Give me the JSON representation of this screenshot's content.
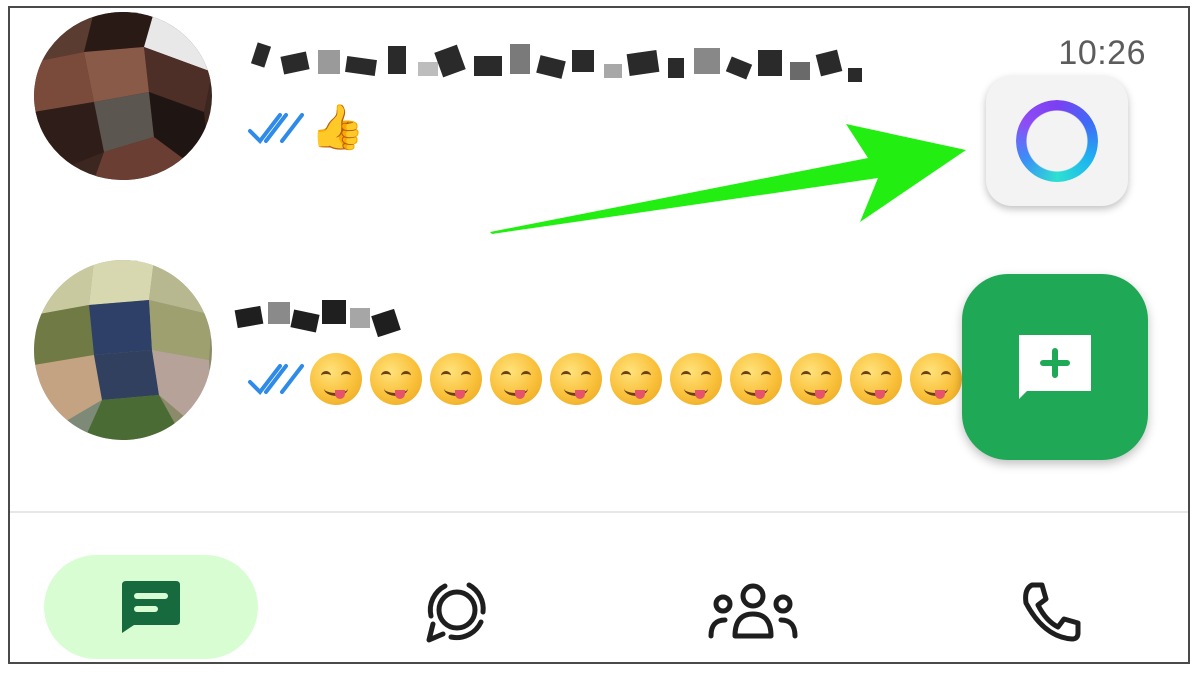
{
  "chats": [
    {
      "name": "",
      "time": "10:26",
      "preview": "👍",
      "read_receipt": "double-check-blue"
    },
    {
      "name": "",
      "time": "",
      "preview_repeat_count": 11,
      "preview_emoji": "face-savoring-food",
      "read_receipt": "double-check-blue"
    }
  ],
  "fabs": {
    "meta_ai_icon": "meta-ai-ring-icon",
    "new_chat_icon": "new-chat-plus-icon"
  },
  "bottom_nav": [
    {
      "id": "chats",
      "icon": "chats-icon",
      "active": true
    },
    {
      "id": "updates",
      "icon": "updates-status-icon",
      "active": false
    },
    {
      "id": "communities",
      "icon": "communities-icon",
      "active": false
    },
    {
      "id": "calls",
      "icon": "calls-phone-icon",
      "active": false
    }
  ],
  "annotation": {
    "arrow_color": "#22ee11",
    "points_to": "meta-ai-button"
  },
  "colors": {
    "accent_green": "#1fa855",
    "active_nav_bg": "#d9fdd3",
    "tick_blue": "#2f8be8",
    "nav_icon_active": "#166a3e",
    "nav_icon": "#1e1e1e"
  }
}
